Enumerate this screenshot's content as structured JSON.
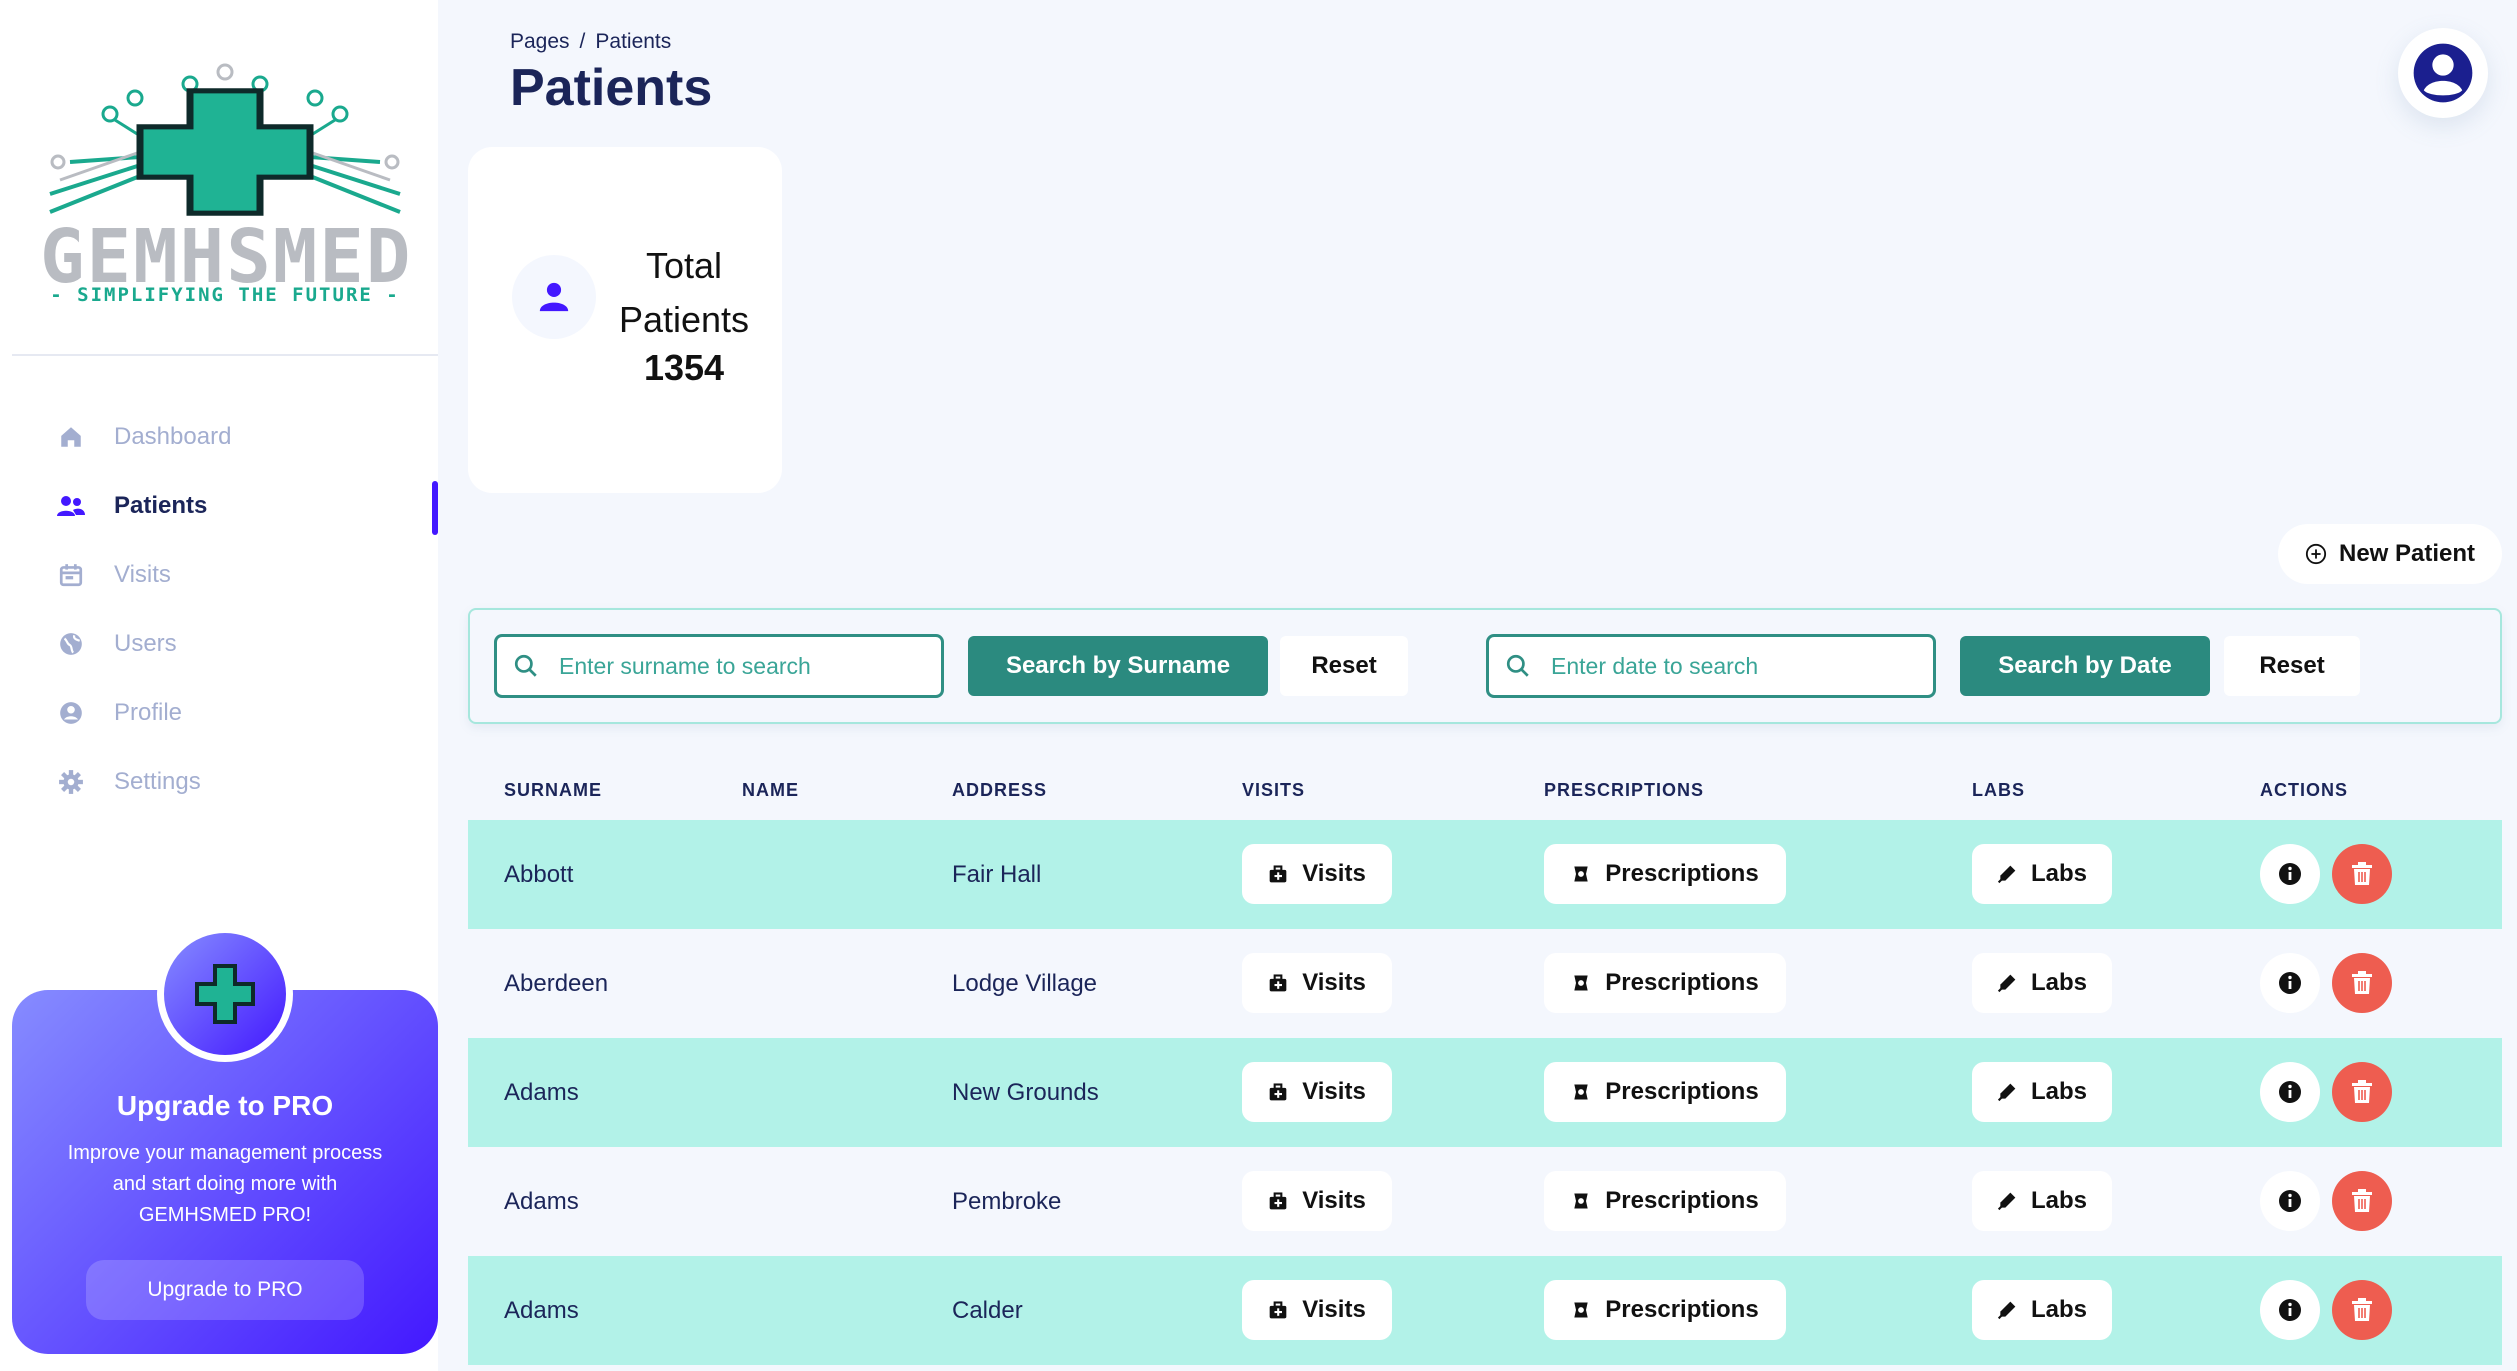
{
  "brand": {
    "name": "GEMHSMED",
    "tagline": "- SIMPLIFYING THE FUTURE -"
  },
  "sidebar": {
    "items": [
      {
        "label": "Dashboard",
        "icon": "home-icon",
        "active": false
      },
      {
        "label": "Patients",
        "icon": "users-icon",
        "active": true
      },
      {
        "label": "Visits",
        "icon": "calendar-icon",
        "active": false
      },
      {
        "label": "Users",
        "icon": "globe-icon",
        "active": false
      },
      {
        "label": "Profile",
        "icon": "user-circle-icon",
        "active": false
      },
      {
        "label": "Settings",
        "icon": "gear-icon",
        "active": false
      }
    ]
  },
  "promo": {
    "title": "Upgrade to PRO",
    "text": "Improve your management process and start doing more with GEMHSMED PRO!",
    "button": "Upgrade to PRO"
  },
  "header": {
    "breadcrumb": [
      "Pages",
      "Patients"
    ],
    "separator": "/",
    "title": "Patients"
  },
  "stats": {
    "label": "Total Patients",
    "value": "1354"
  },
  "toolbar": {
    "new_patient": "New Patient"
  },
  "search": {
    "surname_placeholder": "Enter surname to search",
    "surname_button": "Search by Surname",
    "date_placeholder": "Enter date to search",
    "date_button": "Search by Date",
    "reset": "Reset"
  },
  "table": {
    "columns": [
      "SURNAME",
      "NAME",
      "ADDRESS",
      "VISITS",
      "PRESCRIPTIONS",
      "LABS",
      "ACTIONS"
    ],
    "visits_label": "Visits",
    "prescriptions_label": "Prescriptions",
    "labs_label": "Labs",
    "rows": [
      {
        "surname": "Abbott",
        "name": "",
        "address": "Fair Hall"
      },
      {
        "surname": "Aberdeen",
        "name": "",
        "address": "Lodge Village"
      },
      {
        "surname": "Adams",
        "name": "",
        "address": "New Grounds"
      },
      {
        "surname": "Adams",
        "name": "",
        "address": "Pembroke"
      },
      {
        "surname": "Adams",
        "name": "",
        "address": "Calder"
      }
    ]
  },
  "colors": {
    "accent": "#4318ff",
    "teal": "#2b8a7f",
    "row_alt": "#b2f2e8",
    "danger": "#ee5d50",
    "text": "#1b2559"
  }
}
